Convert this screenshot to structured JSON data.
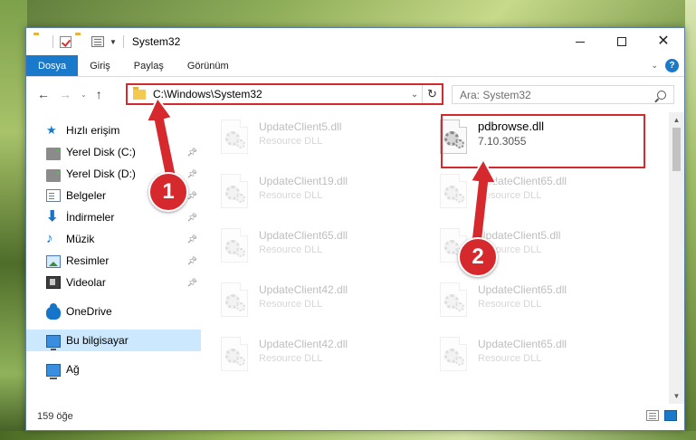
{
  "window": {
    "title": "System32"
  },
  "ribbon": {
    "tabs": [
      {
        "label": "Dosya",
        "active": true
      },
      {
        "label": "Giriş",
        "active": false
      },
      {
        "label": "Paylaş",
        "active": false
      },
      {
        "label": "Görünüm",
        "active": false
      }
    ]
  },
  "address": {
    "path": "C:\\Windows\\System32"
  },
  "search": {
    "placeholder": "Ara: System32"
  },
  "sidebar": {
    "items": [
      {
        "label": "Hızlı erişim",
        "icon": "star-icon",
        "pinned": false
      },
      {
        "label": "Yerel Disk (C:)",
        "icon": "disk-icon",
        "pinned": true
      },
      {
        "label": "Yerel Disk (D:)",
        "icon": "disk-icon",
        "pinned": true
      },
      {
        "label": "Belgeler",
        "icon": "document-icon",
        "pinned": true
      },
      {
        "label": "İndirmeler",
        "icon": "download-icon",
        "pinned": true
      },
      {
        "label": "Müzik",
        "icon": "music-icon",
        "pinned": true
      },
      {
        "label": "Resimler",
        "icon": "pictures-icon",
        "pinned": true
      },
      {
        "label": "Videolar",
        "icon": "video-icon",
        "pinned": true
      },
      {
        "label": "OneDrive",
        "icon": "cloud-icon",
        "pinned": false
      },
      {
        "label": "Bu bilgisayar",
        "icon": "computer-icon",
        "pinned": false,
        "selected": true
      },
      {
        "label": "Ağ",
        "icon": "network-icon",
        "pinned": false
      }
    ]
  },
  "files": [
    {
      "name": "UpdateClient5.dll",
      "type": "Resource DLL",
      "faded": true
    },
    {
      "name": "pdbrowse.dll",
      "type": "7.10.3055",
      "faded": false
    },
    {
      "name": "UpdateClient19.dll",
      "type": "Resource DLL",
      "faded": true
    },
    {
      "name": "UpdateClient65.dll",
      "type": "Resource DLL",
      "faded": true
    },
    {
      "name": "UpdateClient65.dll",
      "type": "Resource DLL",
      "faded": true
    },
    {
      "name": "UpdateClient5.dll",
      "type": "Resource DLL",
      "faded": true
    },
    {
      "name": "UpdateClient42.dll",
      "type": "Resource DLL",
      "faded": true
    },
    {
      "name": "UpdateClient65.dll",
      "type": "Resource DLL",
      "faded": true
    },
    {
      "name": "UpdateClient42.dll",
      "type": "Resource DLL",
      "faded": true
    },
    {
      "name": "UpdateClient65.dll",
      "type": "Resource DLL",
      "faded": true
    }
  ],
  "status": {
    "item_count": "159 öğe"
  },
  "annotations": {
    "step1": "1",
    "step2": "2",
    "color": "#d6292e"
  },
  "colors": {
    "accent": "#1979ca",
    "selection": "#cce8ff"
  }
}
